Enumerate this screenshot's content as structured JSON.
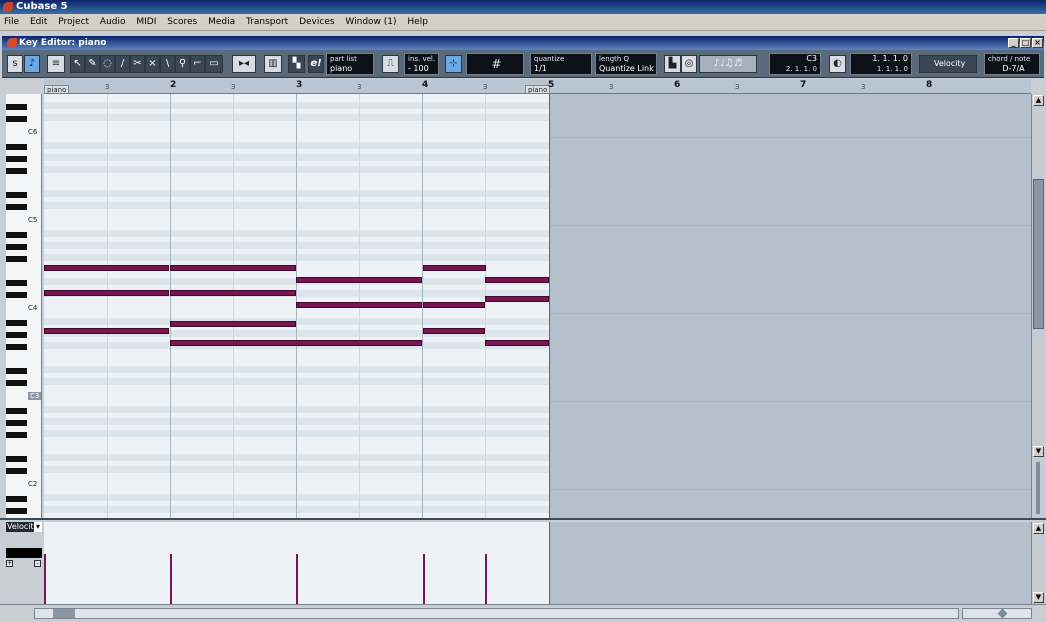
{
  "app": {
    "title": "Cubase 5"
  },
  "menu": [
    "File",
    "Edit",
    "Project",
    "Audio",
    "MIDI",
    "Scores",
    "Media",
    "Transport",
    "Devices",
    "Window (1)",
    "Help"
  ],
  "editor": {
    "title": "Key Editor: piano",
    "part_list": {
      "label": "part list",
      "value": "piano"
    },
    "ins_vel": {
      "label": "ins. vel.",
      "value": "- 100"
    },
    "quantize": {
      "label": "quantize",
      "value": "1/1"
    },
    "length_q": {
      "label": "length Q",
      "value": "Quantize Link"
    },
    "pitch_display": {
      "note": "C3",
      "position": "2. 1. 1.   0"
    },
    "length_display": {
      "top": "1. 1. 1.   0",
      "bottom": "1. 1. 1.   0"
    },
    "velocity_view": "Velocity",
    "chord": {
      "label": "chord / note",
      "value": "D-7/A"
    },
    "snap_symbol": "#"
  },
  "ruler": {
    "part_start_label": "piano",
    "part_end_label": "piano",
    "bars": [
      "2",
      "3",
      "4",
      "5",
      "6",
      "7",
      "8"
    ],
    "beats": [
      "3",
      "3",
      "3",
      "3",
      "3",
      "3",
      "3"
    ]
  },
  "keyboard": {
    "labels": [
      "C6",
      "C5",
      "C4",
      "C3",
      "C2"
    ]
  },
  "lower_zone": {
    "lane_select": "Velocit"
  },
  "colors": {
    "note": "#7b1552",
    "grid_bg": "#eef2f6",
    "outside_bg": "#b3c0cc",
    "part_end": "#4b5cd0"
  }
}
